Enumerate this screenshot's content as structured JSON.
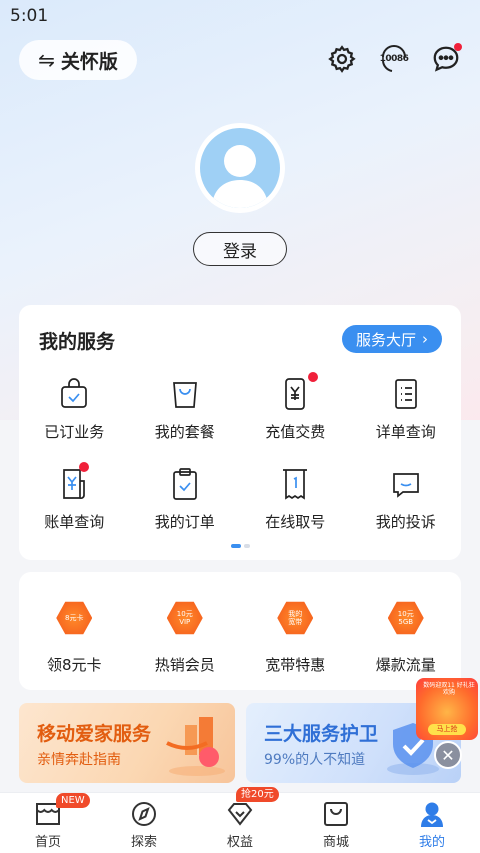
{
  "status_bar": {
    "time": "5:01"
  },
  "header": {
    "care_mode_label": "关怀版",
    "hotline_label": "10086"
  },
  "profile": {
    "login_label": "登录"
  },
  "my_services": {
    "title": "我的服务",
    "hall_label": "服务大厅",
    "items": [
      {
        "label": "已订业务",
        "icon": "subscribed-bag-icon"
      },
      {
        "label": "我的套餐",
        "icon": "shopping-bag-icon"
      },
      {
        "label": "充值交费",
        "icon": "phone-yuan-icon"
      },
      {
        "label": "详单查询",
        "icon": "list-document-icon"
      },
      {
        "label": "账单查询",
        "icon": "bill-yuan-icon"
      },
      {
        "label": "我的订单",
        "icon": "clipboard-check-icon"
      },
      {
        "label": "在线取号",
        "icon": "ticket-number-icon"
      },
      {
        "label": "我的投诉",
        "icon": "chat-complaint-icon"
      }
    ]
  },
  "promos": {
    "items": [
      {
        "label": "领8元卡",
        "badge": [
          "8元卡"
        ]
      },
      {
        "label": "热销会员",
        "badge": [
          "10元",
          "VIP"
        ]
      },
      {
        "label": "宽带特惠",
        "badge": [
          "我的",
          "宽带"
        ]
      },
      {
        "label": "爆款流量",
        "badge": [
          "10元",
          "5GB"
        ]
      }
    ]
  },
  "banners": [
    {
      "title": "移动爱家服务",
      "subtitle": "亲情奔赴指南"
    },
    {
      "title": "三大服务护卫",
      "subtitle": "99%的人不知道"
    }
  ],
  "float_ad": {
    "caption": "数码迎双11 好礼狂欢购",
    "button": "马上抢"
  },
  "tabbar": {
    "items": [
      {
        "label": "首页",
        "badge": "NEW"
      },
      {
        "label": "探索"
      },
      {
        "label": "权益",
        "badge": "抢20元"
      },
      {
        "label": "商城"
      },
      {
        "label": "我的"
      }
    ]
  },
  "colors": {
    "accent": "#3a8ff0",
    "notification": "#f0203a",
    "promo_orange": "#f3561a"
  }
}
